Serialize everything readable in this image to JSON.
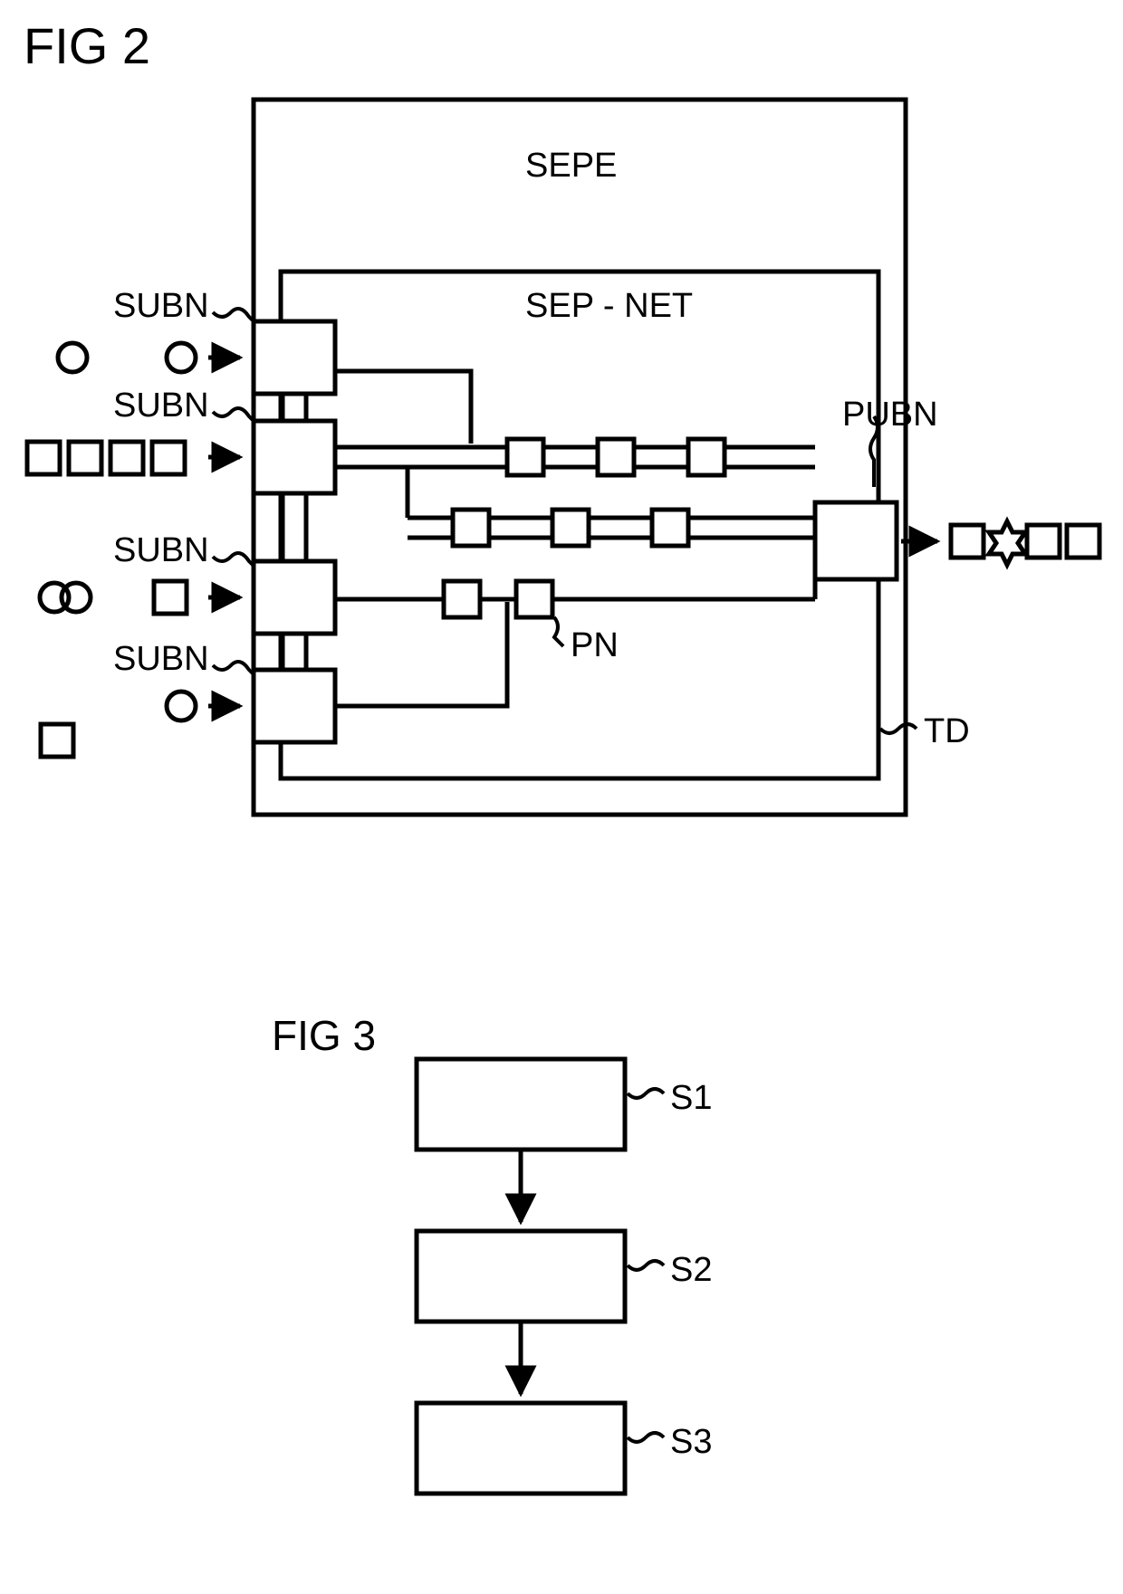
{
  "fig2": {
    "title": "FIG 2",
    "labels": {
      "sepe": "SEPE",
      "sepnet": "SEP - NET",
      "subn1": "SUBN",
      "subn2": "SUBN",
      "subn3": "SUBN",
      "subn4": "SUBN",
      "pubn": "PUBN",
      "pn": "PN",
      "td": "TD"
    }
  },
  "fig3": {
    "title": "FIG 3",
    "labels": {
      "s1": "S1",
      "s2": "S2",
      "s3": "S3"
    }
  }
}
